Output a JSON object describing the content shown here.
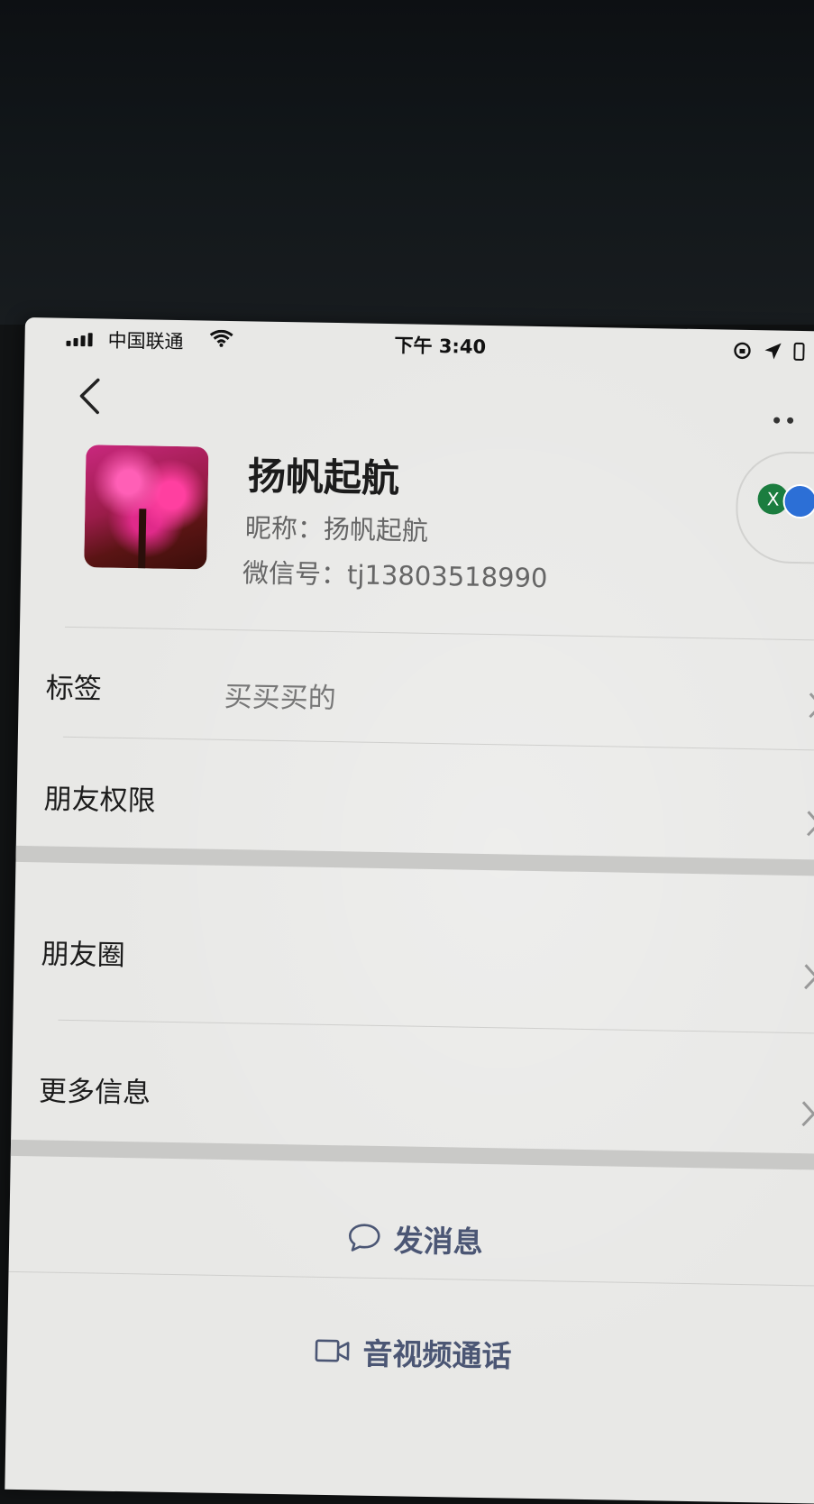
{
  "status_bar": {
    "carrier": "中国联通",
    "time": "下午 3:40"
  },
  "profile": {
    "name": "扬帆起航",
    "nickname_line": "昵称：扬帆起航",
    "wechat_id_line": "微信号：tj13803518990",
    "side_badge": "X"
  },
  "rows": {
    "tags_label": "标签",
    "tags_value": "买买买的",
    "permissions_label": "朋友权限",
    "moments_label": "朋友圈",
    "more_info_label": "更多信息"
  },
  "actions": {
    "message_label": "发消息",
    "call_label": "音视频通话"
  },
  "colors": {
    "action_text": "#4b5674",
    "badge_green": "#1b7d3f",
    "badge_blue": "#2c6fd6"
  }
}
